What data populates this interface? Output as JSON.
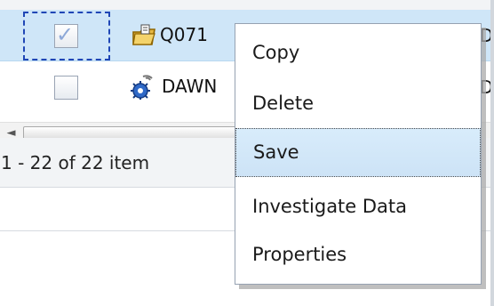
{
  "rows": [
    {
      "name": "Q071",
      "checked": true,
      "selected": true,
      "icon": "folder-report-icon",
      "edge": "D"
    },
    {
      "name": "DAWN",
      "checked": false,
      "selected": false,
      "icon": "blue-gear-process-icon",
      "edge": "D"
    }
  ],
  "pager": {
    "status": "1 - 22 of 22 item"
  },
  "scrollbar": {
    "left_arrow": "◄"
  },
  "context_menu": {
    "items": [
      {
        "label": "Copy",
        "highlighted": false
      },
      {
        "label": "Delete",
        "highlighted": false
      },
      {
        "label": "Save",
        "highlighted": true
      },
      {
        "label": "Investigate Data",
        "highlighted": false
      },
      {
        "label": "Properties",
        "highlighted": false
      }
    ]
  },
  "colors": {
    "selected_row": "#cfe6f8",
    "focus_outline": "#2047b6",
    "menu_highlight": "#d8ecfb",
    "menu_border": "#96a2b2",
    "pager_background": "#f2f4f6"
  }
}
